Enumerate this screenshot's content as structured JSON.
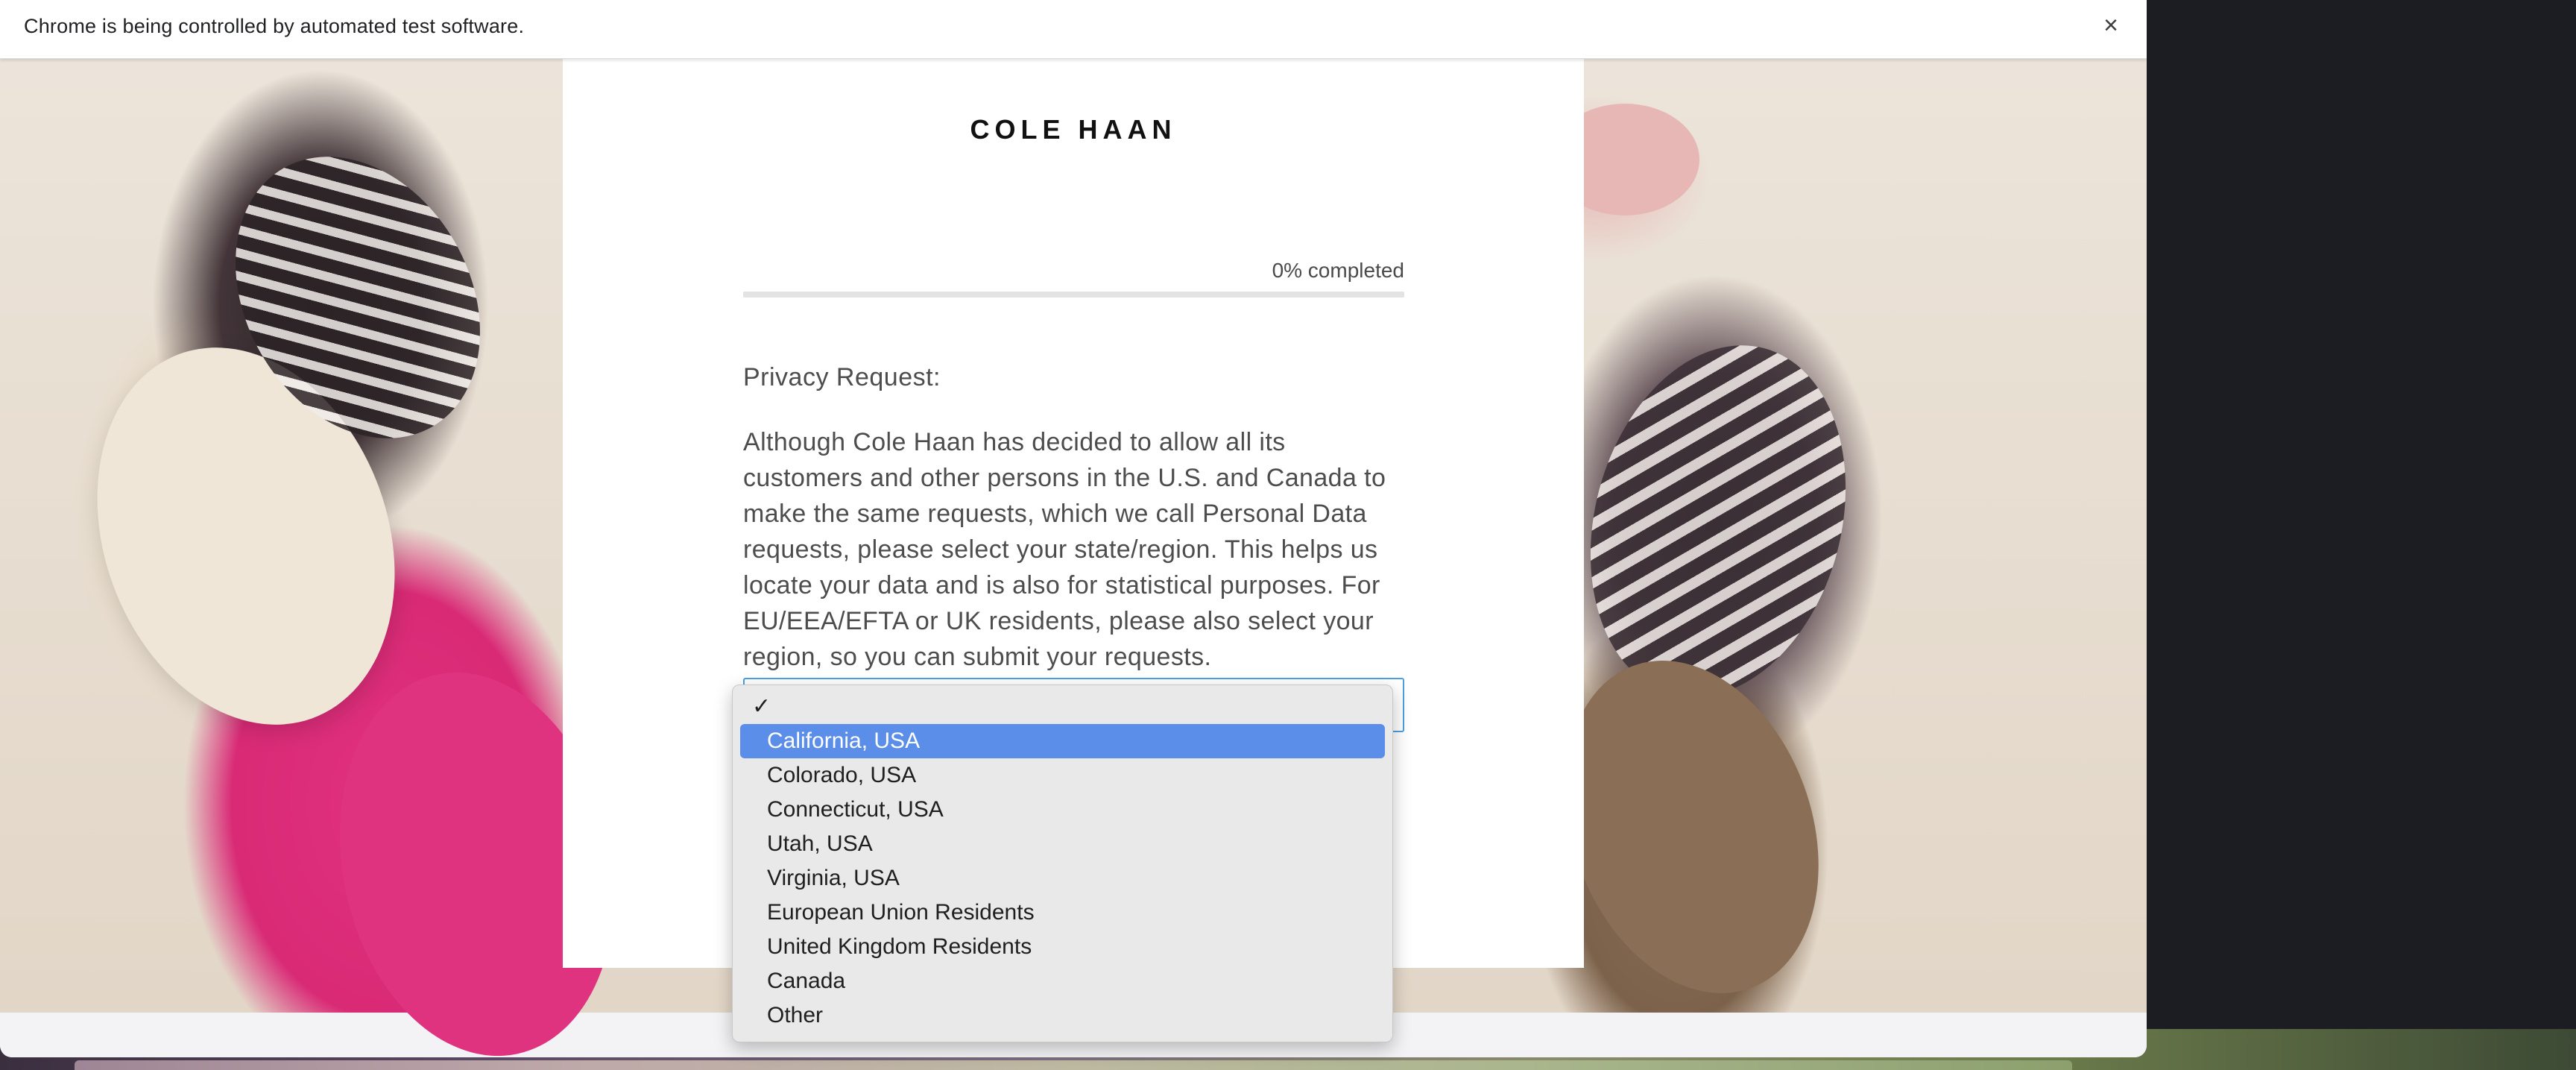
{
  "browser": {
    "infobar_text": "Chrome is being controlled by automated test software.",
    "close_icon": "×"
  },
  "page": {
    "logo": "COLE HAAN",
    "progress_label": "0% completed",
    "progress_fraction": 0,
    "question_title": "Privacy Request:",
    "question_body": "Although Cole Haan has decided to allow all its customers and other persons in the U.S. and Canada to make the same requests, which we call Personal Data requests, please select your state/region. This helps us locate your data and is also for statistical purposes. For EU/EEA/EFTA or UK residents, please also select your region, so you can submit your requests.",
    "select_value": ""
  },
  "dropdown": {
    "check_mark": "✓",
    "options": [
      "California, USA",
      "Colorado, USA",
      "Connecticut, USA",
      "Utah, USA",
      "Virginia, USA",
      "European Union Residents",
      "United Kingdom Residents",
      "Canada",
      "Other"
    ],
    "highlighted": "California, USA"
  },
  "colors": {
    "highlight": "#5b8ee8",
    "select_border": "#4b9fe3"
  }
}
